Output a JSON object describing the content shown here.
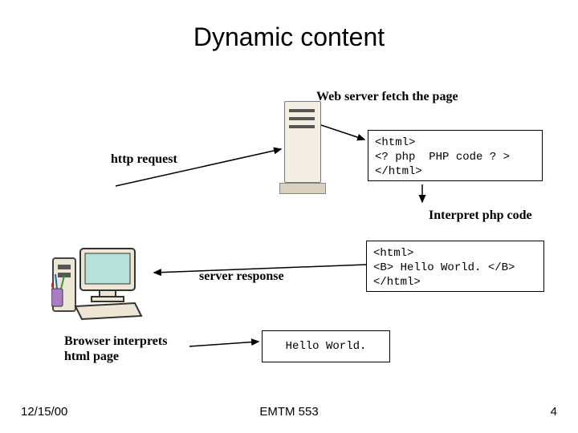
{
  "title": "Dynamic content",
  "labels": {
    "fetch": "Web server fetch the page",
    "http_request": "http request",
    "interpret": "Interpret php code",
    "server_response": "server response",
    "browser_interprets_l1": "Browser interprets",
    "browser_interprets_l2": "html page"
  },
  "code": {
    "php": "<html>\n<? php  PHP code ? >\n</html>",
    "html_out": "<html>\n<B> Hello World. </B>\n</html>",
    "rendered": "Hello World."
  },
  "footer": {
    "date": "12/15/00",
    "course": "EMTM 553",
    "page": "4"
  }
}
